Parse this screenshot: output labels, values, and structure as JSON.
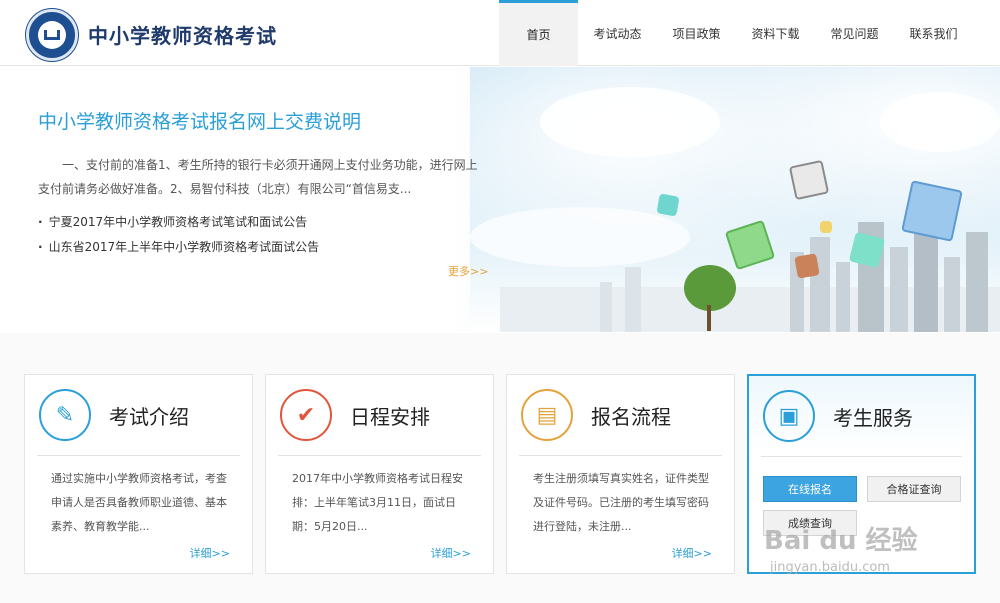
{
  "header": {
    "site_title": "中小学教师资格考试",
    "logo_icon": "emblem-logo-icon",
    "nav": [
      {
        "label": "首页",
        "active": true
      },
      {
        "label": "考试动态",
        "active": false
      },
      {
        "label": "项目政策",
        "active": false
      },
      {
        "label": "资料下载",
        "active": false
      },
      {
        "label": "常见问题",
        "active": false
      },
      {
        "label": "联系我们",
        "active": false
      }
    ]
  },
  "banner": {
    "title": "中小学教师资格考试报名网上交费说明",
    "desc": "一、支付前的准备1、考生所持的银行卡必须开通网上支付业务功能，进行网上支付前请务必做好准备。2、易智付科技（北京）有限公司“首信易支...",
    "news": [
      "宁夏2017年中小学教师资格考试笔试和面试公告",
      "山东省2017年上半年中小学教师资格考试面试公告"
    ],
    "more": "更多>>"
  },
  "cards": [
    {
      "title": "考试介绍",
      "icon": "document-edit-icon",
      "text": "通过实施中小学教师资格考试，考查申请人是否具备教师职业道德、基本素养、教育教学能...",
      "more": "详细>>"
    },
    {
      "title": "日程安排",
      "icon": "checkmark-icon",
      "text": "2017年中小学教师资格考试日程安排：上半年笔试3月11日，面试日期：5月20日...",
      "more": "详细>>"
    },
    {
      "title": "报名流程",
      "icon": "card-pencil-icon",
      "text": "考生注册须填写真实姓名，证件类型及证件号码。已注册的考生填写密码进行登陆，未注册...",
      "more": "详细>>"
    },
    {
      "title": "考生服务",
      "icon": "contact-book-icon",
      "buttons": [
        "在线报名",
        "合格证查询",
        "成绩查询"
      ]
    }
  ],
  "watermark": {
    "text": "Bai du 经验",
    "sub": "jingyan.baidu.com"
  },
  "colors": {
    "accent": "#2a9fd8",
    "title_blue": "#1f3a6b",
    "more_orange": "#e5a23a",
    "icon_red": "#e1553b",
    "icon_orange": "#e5a23a"
  }
}
